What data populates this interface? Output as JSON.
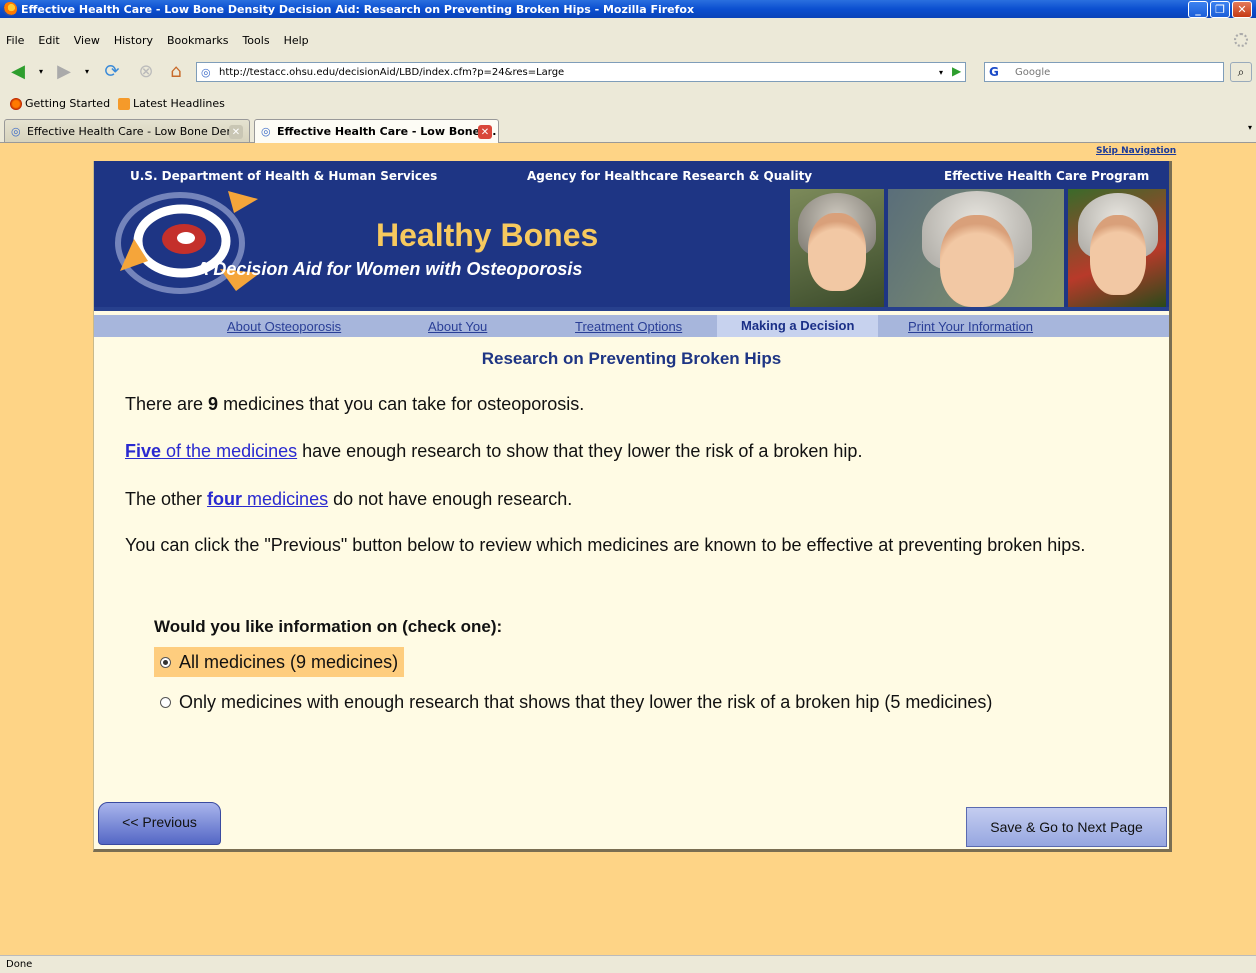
{
  "window": {
    "title": "Effective Health Care - Low Bone Density Decision Aid: Research on Preventing Broken Hips - Mozilla Firefox",
    "minimize": "_",
    "maximize": "❐",
    "close": "✕"
  },
  "menu": [
    "File",
    "Edit",
    "View",
    "History",
    "Bookmarks",
    "Tools",
    "Help"
  ],
  "toolbar": {
    "url": "http://testacc.ohsu.edu/decisionAid/LBD/index.cfm?p=24&res=Large",
    "search_engine": "G",
    "search_placeholder": "Google"
  },
  "bookmarks": [
    "Getting Started",
    "Latest Headlines"
  ],
  "tabs": [
    {
      "label": "Effective Health Care - Low Bone Den...",
      "active": false
    },
    {
      "label": "Effective Health Care - Low Bone ...",
      "active": true
    }
  ],
  "page": {
    "skip_nav": "Skip Navigation",
    "banner": {
      "hhs": "U.S. Department of Health & Human Services",
      "ahrq": "Agency for Healthcare Research & Quality",
      "ehc": "Effective Health Care Program",
      "title": "Healthy Bones",
      "subtitle": "A Decision Aid for Women with Osteoporosis"
    },
    "nav": [
      {
        "label": "About Osteoporosis",
        "current": false
      },
      {
        "label": "About You",
        "current": false
      },
      {
        "label": "Treatment Options",
        "current": false
      },
      {
        "label": "Making a Decision",
        "current": true
      },
      {
        "label": "Print Your Information",
        "current": false
      }
    ],
    "heading": "Research on Preventing Broken Hips",
    "p1_pre": "There are ",
    "p1_num": "9",
    "p1_post": " medicines that you can take for osteoporosis.",
    "p2_link_bold": "Five",
    "p2_link_rest": " of the medicines",
    "p2_post": " have enough research to show that they lower the risk of a broken hip.",
    "p3_pre": "The other ",
    "p3_link_bold": "four",
    "p3_link_rest": " medicines",
    "p3_post": " do not have enough research.",
    "p4": "You can click the \"Previous\" button below to review which medicines are known to be effective at preventing broken hips.",
    "question": "Would you like information on (check one):",
    "options": [
      {
        "label": "All medicines (9 medicines)",
        "selected": true
      },
      {
        "label": "Only medicines with enough research that shows that they lower the risk of a broken hip (5 medicines)",
        "selected": false
      }
    ],
    "prev_button": "<< Previous",
    "next_button": "Save & Go to Next Page"
  },
  "status": "Done",
  "colors": {
    "page_bg": "#fed486",
    "banner_bg": "#1e3584",
    "title_gold": "#f7c95e",
    "link_blue": "#2a2ad0",
    "selected_option": "#fecd7e"
  }
}
